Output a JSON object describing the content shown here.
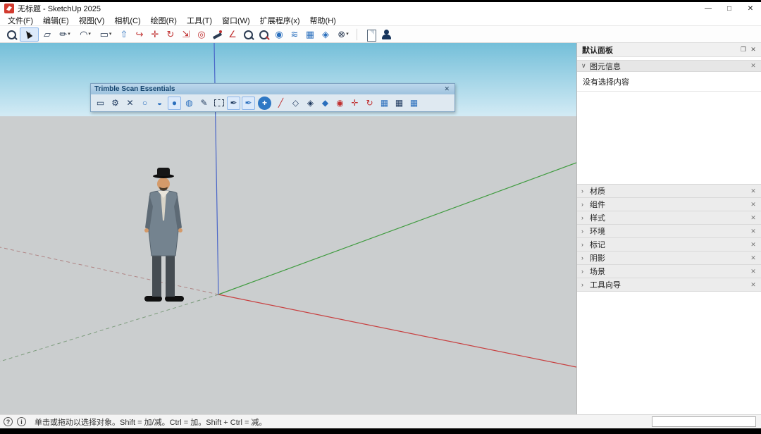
{
  "window": {
    "title": "无标题 - SketchUp 2025",
    "minimize_glyph": "—",
    "maximize_glyph": "□",
    "close_glyph": "✕"
  },
  "ui": {
    "caret_glyph": "▾"
  },
  "menu": {
    "items": [
      {
        "name": "menu-file",
        "label": "文件(F)"
      },
      {
        "name": "menu-edit",
        "label": "编辑(E)"
      },
      {
        "name": "menu-view",
        "label": "视图(V)"
      },
      {
        "name": "menu-camera",
        "label": "相机(C)"
      },
      {
        "name": "menu-draw",
        "label": "绘图(R)"
      },
      {
        "name": "menu-tools",
        "label": "工具(T)"
      },
      {
        "name": "menu-window",
        "label": "窗口(W)"
      },
      {
        "name": "menu-extensions",
        "label": "扩展程序(x)"
      },
      {
        "name": "menu-help",
        "label": "帮助(H)"
      }
    ]
  },
  "main_toolbar": {
    "icons": [
      {
        "name": "search-tool-icon",
        "glyph": "",
        "cls": "c-mag"
      },
      {
        "name": "select-tool",
        "glyph": "",
        "cls": "c-cursor pressed caret"
      },
      {
        "name": "eraser-tool",
        "glyph": "▱",
        "cls": "dark"
      },
      {
        "name": "freehand-tool",
        "glyph": "✏",
        "cls": "dark caret"
      },
      {
        "name": "arc-tool",
        "glyph": "◠",
        "cls": "dark caret"
      },
      {
        "name": "rectangle-tool",
        "glyph": "▭",
        "cls": "dark caret"
      },
      {
        "name": "pushpull-tool",
        "glyph": "⇧",
        "cls": "blue"
      },
      {
        "name": "followme-tool",
        "glyph": "↪",
        "cls": "red"
      },
      {
        "name": "move-tool",
        "glyph": "✛",
        "cls": "red"
      },
      {
        "name": "rotate-tool",
        "glyph": "↻",
        "cls": "red"
      },
      {
        "name": "scale-tool",
        "glyph": "⇲",
        "cls": "red"
      },
      {
        "name": "offset-tool",
        "glyph": "◎",
        "cls": "red"
      },
      {
        "name": "tape-measure-tool",
        "glyph": "",
        "cls": "c-tape"
      },
      {
        "name": "protractor-tool",
        "glyph": "∠",
        "cls": "red"
      },
      {
        "name": "zoom-tool-icon",
        "glyph": "",
        "cls": "c-mag"
      },
      {
        "name": "zoom-extents-tool",
        "glyph": "",
        "cls": "c-mag red-accent"
      },
      {
        "name": "geolocation-tool",
        "glyph": "◉",
        "cls": "blue"
      },
      {
        "name": "sandbox-contours-tool",
        "glyph": "≋",
        "cls": "blue"
      },
      {
        "name": "sandbox-scratch-tool",
        "glyph": "▦",
        "cls": "blue"
      },
      {
        "name": "smoove-tool",
        "glyph": "◈",
        "cls": "blue"
      },
      {
        "name": "walkthrough-tool",
        "glyph": "⊗",
        "cls": "dark caret"
      },
      {
        "name": "toolbar-separator",
        "glyph": "",
        "cls": "sep"
      },
      {
        "name": "new-file-button",
        "glyph": "",
        "cls": "c-doc"
      },
      {
        "name": "signin-button",
        "glyph": "",
        "cls": "c-person"
      }
    ]
  },
  "scan_toolbar": {
    "title": "Trimble Scan Essentials",
    "close_glyph": "✕",
    "icons": [
      {
        "name": "scan-region-icon",
        "glyph": "▭",
        "cls": "navy"
      },
      {
        "name": "scan-settings-gear-icon",
        "glyph": "⚙",
        "cls": "navy"
      },
      {
        "name": "scan-delete-icon",
        "glyph": "✕",
        "cls": "navy"
      },
      {
        "name": "point-density-low-icon",
        "glyph": "○",
        "cls": "blue"
      },
      {
        "name": "point-density-mid-icon",
        "glyph": "◒",
        "cls": "blue"
      },
      {
        "name": "point-density-full-icon",
        "glyph": "●",
        "cls": "blue pressed"
      },
      {
        "name": "point-style-icon",
        "glyph": "◍",
        "cls": "blue"
      },
      {
        "name": "scan-edit-icon",
        "glyph": "✎",
        "cls": "navy"
      },
      {
        "name": "scan-lasso-icon",
        "glyph": "",
        "cls": "c-dash"
      },
      {
        "name": "scan-eyedropper-icon",
        "glyph": "✒",
        "cls": "navy pressed"
      },
      {
        "name": "scan-eyedropper-alt-icon",
        "glyph": "✒",
        "cls": "blue pressed"
      },
      {
        "name": "scan-add-point-icon",
        "glyph": "+",
        "cls": "c-plus"
      },
      {
        "name": "scan-line-icon",
        "glyph": "╱",
        "cls": "red"
      },
      {
        "name": "cloud-box-icon",
        "glyph": "◇",
        "cls": "navy"
      },
      {
        "name": "cloud-box-alt-icon",
        "glyph": "◈",
        "cls": "navy"
      },
      {
        "name": "cloud-box-filled-icon",
        "glyph": "◆",
        "cls": "blue"
      },
      {
        "name": "cloud-target-icon",
        "glyph": "◉",
        "cls": "red"
      },
      {
        "name": "snap-point-icon",
        "glyph": "✛",
        "cls": "red"
      },
      {
        "name": "snap-rotate-icon",
        "glyph": "↻",
        "cls": "red"
      },
      {
        "name": "panel-grid-icon",
        "glyph": "▦",
        "cls": "blue"
      },
      {
        "name": "panel-grid-alt-icon",
        "glyph": "▦",
        "cls": "navy"
      },
      {
        "name": "panel-grid-third-icon",
        "glyph": "▦",
        "cls": "blue"
      }
    ]
  },
  "panel": {
    "title": "默认面板",
    "restore_glyph": "❐",
    "close_glyph": "✕",
    "section_chevron": "›",
    "entity_info": {
      "label": "图元信息",
      "chevron": "∨",
      "empty_text": "没有选择内容"
    },
    "sections": [
      {
        "name": "section-materials",
        "label": "材质"
      },
      {
        "name": "section-components",
        "label": "组件"
      },
      {
        "name": "section-styles",
        "label": "样式"
      },
      {
        "name": "section-environment",
        "label": "环境"
      },
      {
        "name": "section-tags",
        "label": "标记"
      },
      {
        "name": "section-shadows",
        "label": "阴影"
      },
      {
        "name": "section-scenes",
        "label": "场景"
      },
      {
        "name": "section-instructor",
        "label": "工具向导"
      }
    ]
  },
  "statusbar": {
    "help_glyph": "?",
    "info_glyph": "i",
    "hint": "单击或拖动以选择对象。Shift = 加/减。Ctrl = 加。Shift + Ctrl = 减。",
    "measurement_value": ""
  },
  "colors": {
    "axis_red": "#c84040",
    "axis_green": "#3f9b3f",
    "axis_blue": "#4a66c8",
    "sky_top": "#74bfd9",
    "sky_horizon": "#d3ebf5",
    "ground": "#cbcecf",
    "accent_blue": "#2a6fbd",
    "icon_red": "#c03030",
    "icon_navy": "#1f3a5f"
  }
}
